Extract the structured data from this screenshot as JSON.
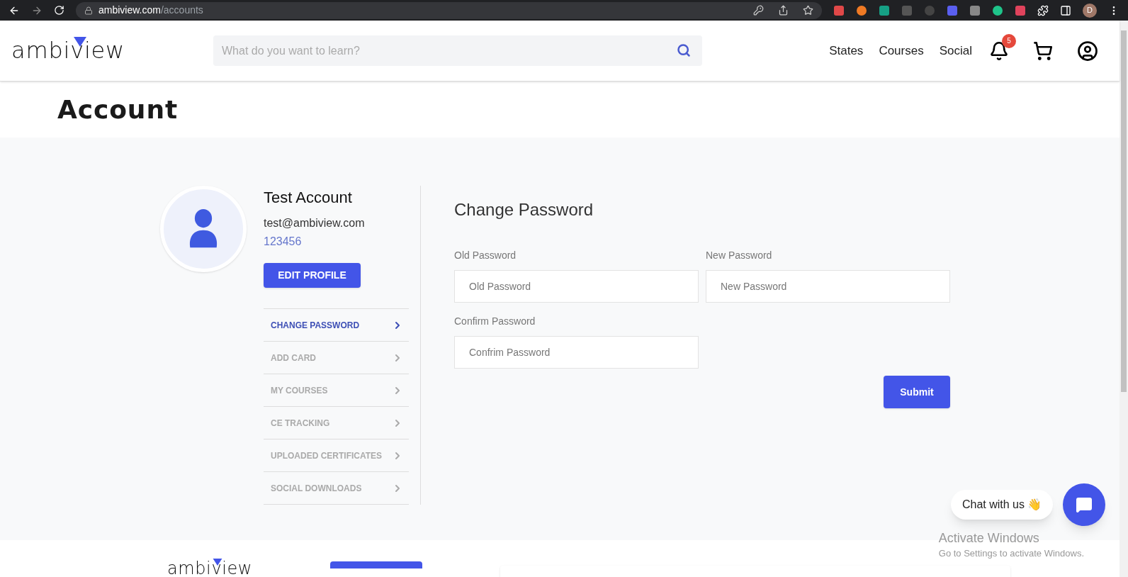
{
  "browser": {
    "url_host": "ambiview.com",
    "url_path": "/accounts",
    "profile_initial": "D"
  },
  "header": {
    "logo": "ambiview",
    "search": {
      "placeholder": "What do you want to learn?"
    },
    "nav": [
      "States",
      "Courses",
      "Social"
    ],
    "notification_count": "5"
  },
  "page_title": "Account",
  "profile": {
    "name": "Test Account",
    "email": "test@ambiview.com",
    "id": "123456",
    "edit_button": "EDIT PROFILE"
  },
  "menu": [
    {
      "label": "CHANGE PASSWORD",
      "selected": true
    },
    {
      "label": "ADD CARD",
      "selected": false
    },
    {
      "label": "MY COURSES",
      "selected": false
    },
    {
      "label": "CE TRACKING",
      "selected": false
    },
    {
      "label": "UPLOADED CERTIFICATES",
      "selected": false
    },
    {
      "label": "SOCIAL DOWNLOADS",
      "selected": false
    }
  ],
  "form": {
    "title": "Change Password",
    "fields": [
      {
        "label": "Old Password",
        "placeholder": "Old Password"
      },
      {
        "label": "New Password",
        "placeholder": "New Password"
      },
      {
        "label": "Confirm Password",
        "placeholder": "Confrim Password"
      }
    ],
    "submit": "Submit"
  },
  "chat": {
    "label": "Chat with us",
    "emoji": "👋"
  },
  "footer": {
    "logo": "ambiview"
  },
  "os_notice": {
    "title": "Activate Windows",
    "text": "Go to Settings to activate Windows."
  }
}
